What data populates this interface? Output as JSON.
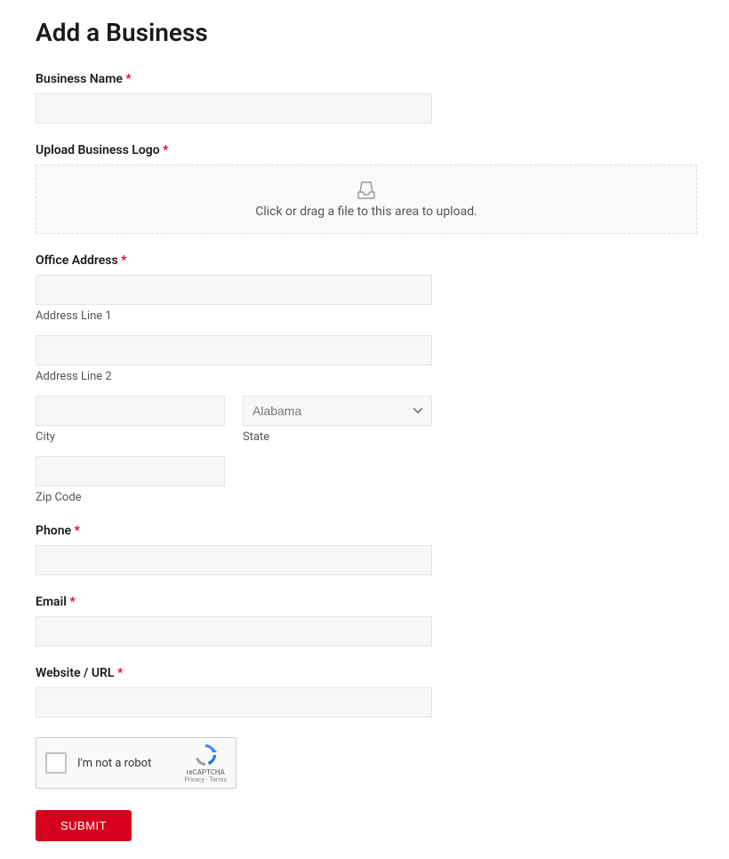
{
  "page": {
    "title": "Add a Business"
  },
  "fields": {
    "business_name": {
      "label": "Business Name",
      "required": "*"
    },
    "upload_logo": {
      "label": "Upload Business Logo",
      "required": "*",
      "hint": "Click or drag a file to this area to upload."
    },
    "office_address": {
      "label": "Office Address",
      "required": "*",
      "line1_sublabel": "Address Line 1",
      "line2_sublabel": "Address Line 2",
      "city_sublabel": "City",
      "state_sublabel": "State",
      "state_selected": "Alabama",
      "zip_sublabel": "Zip Code"
    },
    "phone": {
      "label": "Phone",
      "required": "*"
    },
    "email": {
      "label": "Email",
      "required": "*"
    },
    "website": {
      "label": "Website / URL",
      "required": "*"
    }
  },
  "captcha": {
    "label": "I'm not a robot",
    "brand": "reCAPTCHA",
    "terms": "Privacy - Terms"
  },
  "submit": {
    "label": "SUBMIT"
  }
}
